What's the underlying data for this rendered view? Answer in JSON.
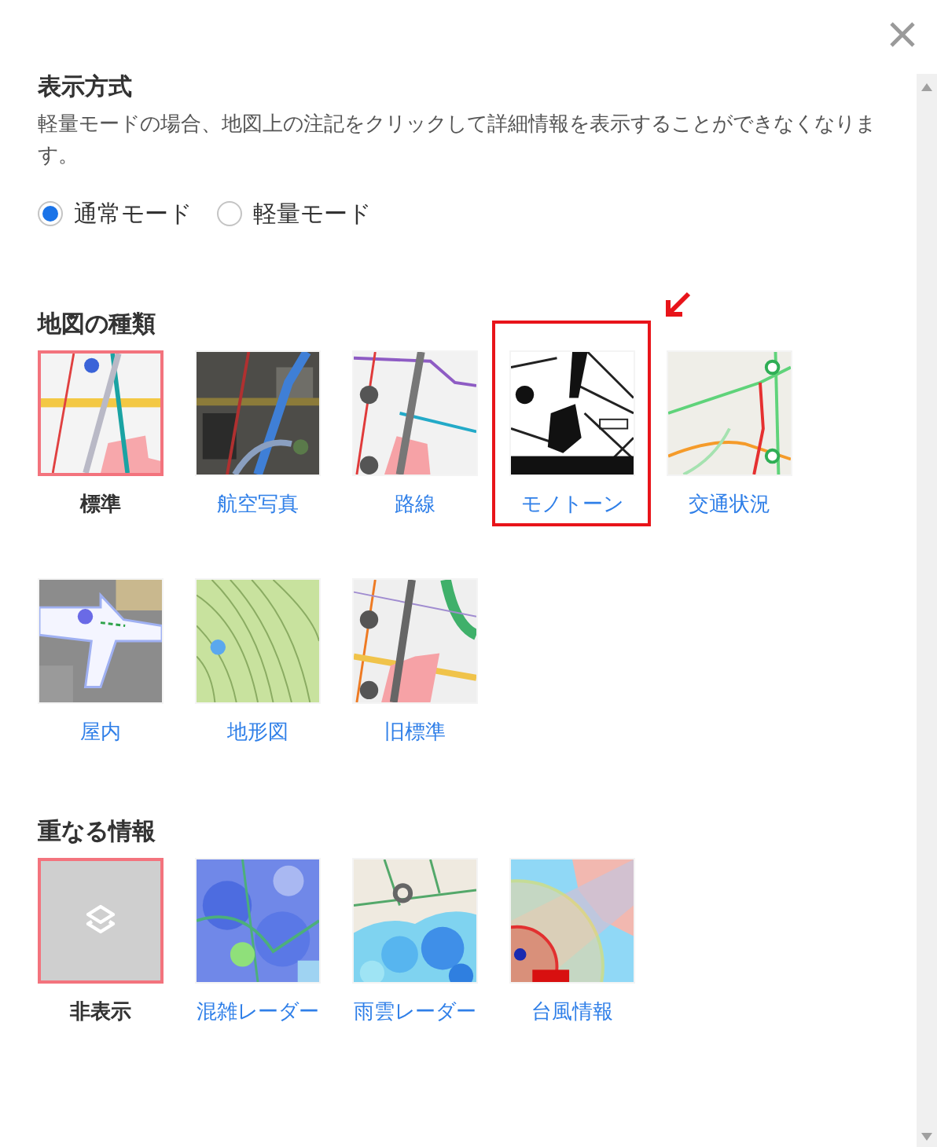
{
  "display_mode": {
    "title": "表示方式",
    "description": "軽量モードの場合、地図上の注記をクリックして詳細情報を表示することができなくなります。",
    "options": [
      {
        "label": "通常モード",
        "selected": true
      },
      {
        "label": "軽量モード",
        "selected": false
      }
    ]
  },
  "map_types": {
    "title": "地図の種類",
    "items": [
      {
        "label": "標準",
        "selected": true,
        "highlighted": false
      },
      {
        "label": "航空写真",
        "selected": false,
        "highlighted": false
      },
      {
        "label": "路線",
        "selected": false,
        "highlighted": false
      },
      {
        "label": "モノトーン",
        "selected": false,
        "highlighted": true
      },
      {
        "label": "交通状況",
        "selected": false,
        "highlighted": false
      },
      {
        "label": "屋内",
        "selected": false,
        "highlighted": false
      },
      {
        "label": "地形図",
        "selected": false,
        "highlighted": false
      },
      {
        "label": "旧標準",
        "selected": false,
        "highlighted": false
      }
    ]
  },
  "overlays": {
    "title": "重なる情報",
    "items": [
      {
        "label": "非表示",
        "selected": true,
        "kind": "icon"
      },
      {
        "label": "混雑レーダー",
        "selected": false,
        "kind": "picture"
      },
      {
        "label": "雨雲レーダー",
        "selected": false,
        "kind": "picture"
      },
      {
        "label": "台風情報",
        "selected": false,
        "kind": "picture"
      }
    ]
  }
}
